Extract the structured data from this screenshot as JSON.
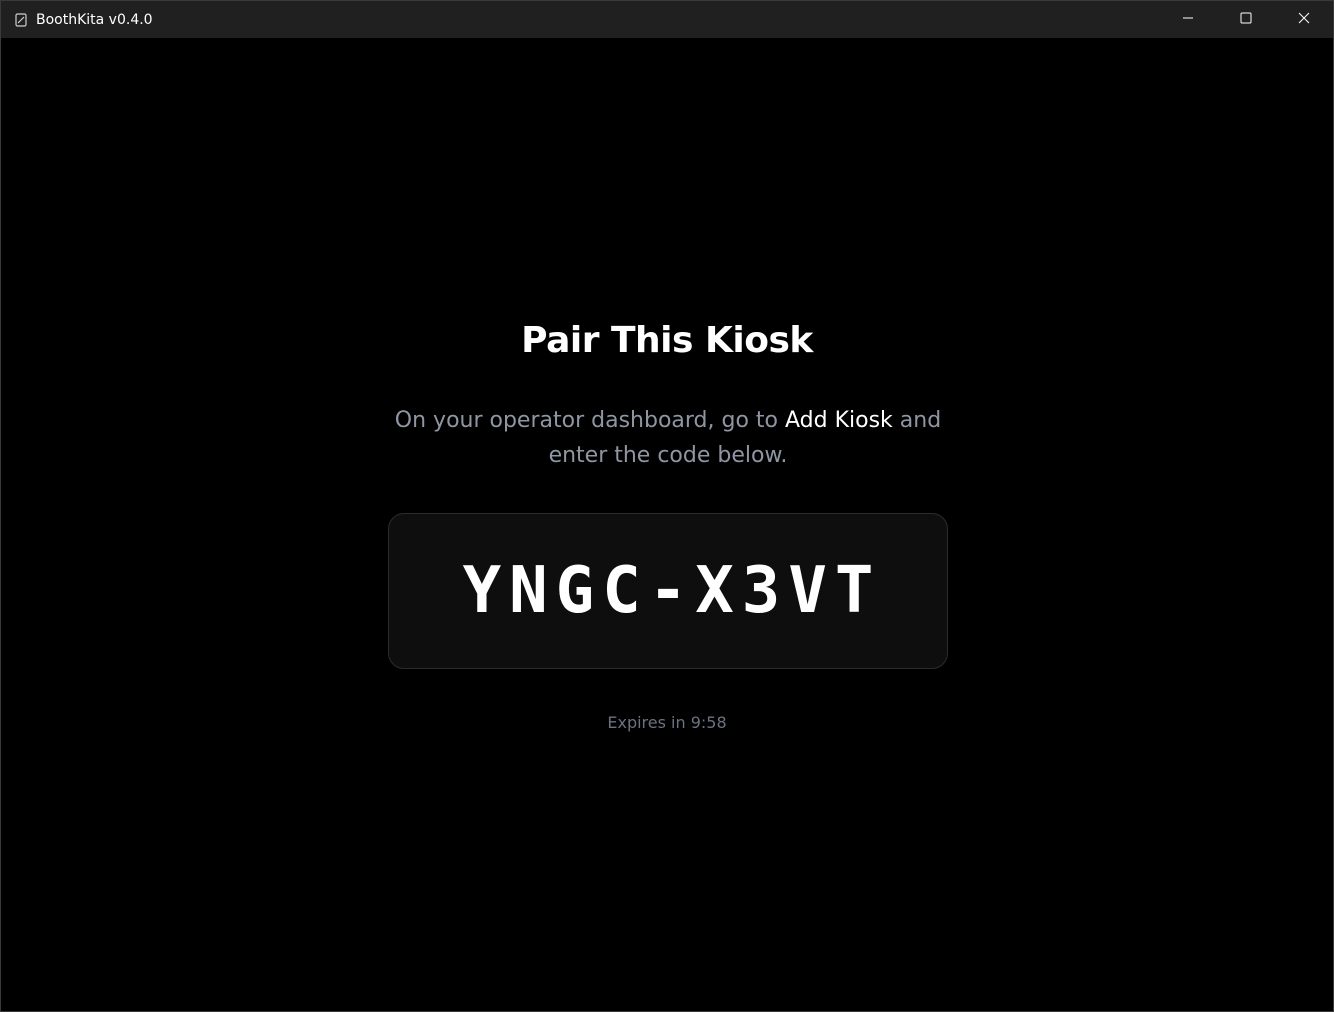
{
  "window": {
    "title": "BoothKita v0.4.0",
    "icons": {
      "app": "app-document-icon",
      "minimize": "minimize-icon",
      "maximize": "maximize-icon",
      "close": "close-icon"
    }
  },
  "pairing": {
    "heading": "Pair This Kiosk",
    "instruction_before": "On your operator dashboard, go to ",
    "instruction_highlight": "Add Kiosk",
    "instruction_after": " and enter the code below.",
    "code": "YNGC-X3VT",
    "expiry_label": "Expires in ",
    "expiry_time": "9:58"
  },
  "colors": {
    "background": "#000000",
    "titlebar": "#202020",
    "muted_text": "#8f96a3",
    "code_box": "#0e0e0e"
  }
}
